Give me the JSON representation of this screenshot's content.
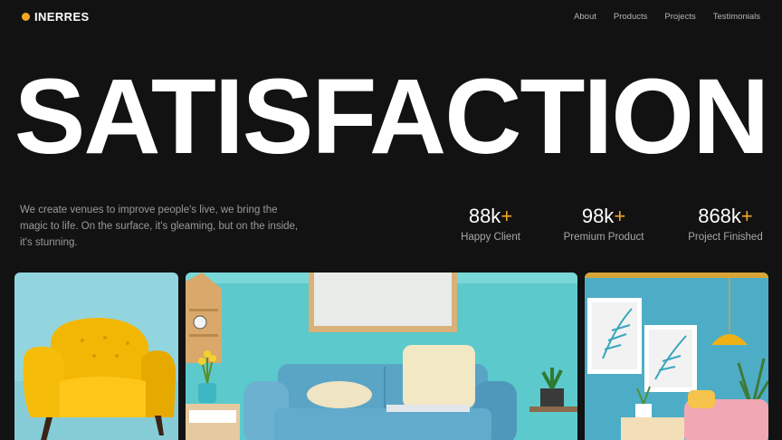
{
  "brand": {
    "name": "INERRES",
    "accent": "#f5a623"
  },
  "nav": [
    "About",
    "Products",
    "Projects",
    "Testimonials"
  ],
  "hero": {
    "title": "SATISFACTION"
  },
  "description": "We create venues to improve people's live, we bring the magic to life. On the surface, it's gleaming, but on the inside, it's stunning.",
  "stats": [
    {
      "value": "88k",
      "suffix": "+",
      "label": "Happy Client"
    },
    {
      "value": "98k",
      "suffix": "+",
      "label": "Premium Product"
    },
    {
      "value": "868k",
      "suffix": "+",
      "label": "Project Finished"
    }
  ],
  "cards": [
    {
      "subject": "yellow-armchair",
      "background": "#8fd3dc"
    },
    {
      "subject": "blue-sofa-living-room",
      "background": "#63c9cc"
    },
    {
      "subject": "pink-sofa-room",
      "background": "#4fb0c6"
    }
  ]
}
